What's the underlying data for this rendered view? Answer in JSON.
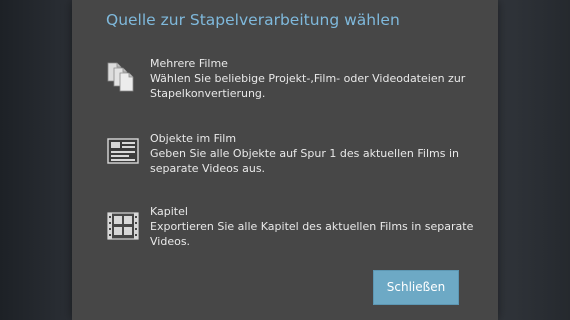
{
  "dialog": {
    "title": "Quelle zur Stapelverarbeitung wählen",
    "options": [
      {
        "icon": "documents-stack-icon",
        "title": "Mehrere Filme",
        "description": "Wählen Sie beliebige Projekt-,Film- oder Videodateien zur Stapelkonvertierung."
      },
      {
        "icon": "film-objects-icon",
        "title": "Objekte im Film",
        "description": "Geben Sie alle Objekte auf Spur 1 des aktuellen Films in separate Videos aus."
      },
      {
        "icon": "chapters-icon",
        "title": "Kapitel",
        "description": "Exportieren Sie alle Kapitel des aktuellen Films in separate Videos."
      }
    ],
    "close_label": "Schließen"
  },
  "colors": {
    "title": "#7fb9dc",
    "dialog_bg": "#474747",
    "button_bg": "#6da9c5",
    "text": "#e9e9e9"
  }
}
